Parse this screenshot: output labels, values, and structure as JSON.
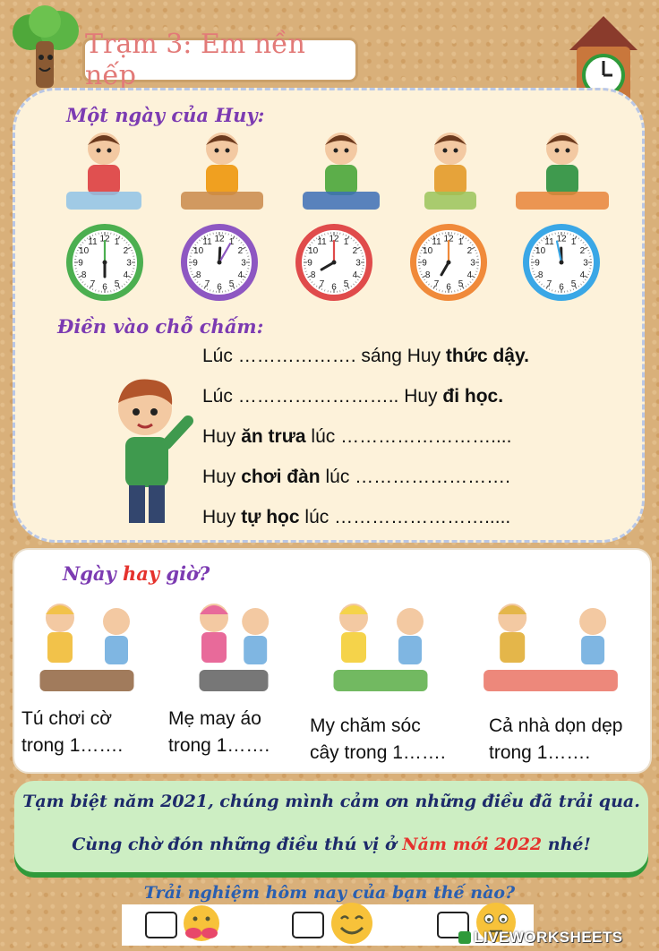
{
  "title": "Trạm 3: Em nền nếp",
  "schedule": {
    "heading": "Một ngày của Huy:",
    "activities": [
      {
        "name": "wake-up",
        "icon": "boy-waking-in-bed"
      },
      {
        "name": "play-guitar",
        "icon": "boy-playing-guitar"
      },
      {
        "name": "study",
        "icon": "boy-studying-at-desk"
      },
      {
        "name": "go-to-school",
        "icon": "boy-walking-to-school"
      },
      {
        "name": "lunch",
        "icon": "boy-eating-lunch"
      }
    ],
    "clocks": [
      {
        "color": "#4caf50",
        "hour": 6,
        "minute": 0
      },
      {
        "color": "#8e57c2",
        "hour": 12,
        "minute": 5
      },
      {
        "color": "#e04b4b",
        "hour": 8,
        "minute": 0
      },
      {
        "color": "#f08a3a",
        "hour": 7,
        "minute": 0
      },
      {
        "color": "#3aa7e6",
        "hour": 11,
        "minute": 58
      }
    ],
    "clock_numbers": [
      "12",
      "1",
      "2",
      "3",
      "4",
      "5",
      "6",
      "7",
      "8",
      "9",
      "10",
      "11"
    ]
  },
  "fill": {
    "heading": "Điền vào chỗ chấm:",
    "lines": [
      {
        "a": "Lúc ………………. sáng Huy ",
        "b": "thức dậy."
      },
      {
        "a": "Lúc …………………….. Huy ",
        "b": "đi học."
      },
      {
        "a": "Huy ",
        "b": "ăn trưa",
        "c": " lúc ……………………...."
      },
      {
        "a": "Huy ",
        "b": "chơi đàn",
        "c": " lúc ……………………."
      },
      {
        "a": "Huy ",
        "b": "tự học",
        "c": " lúc ……………………....."
      }
    ]
  },
  "day_or_hour": {
    "heading_a": "Ngày ",
    "heading_b": "hay",
    "heading_c": " giờ?",
    "items": [
      {
        "caption": "Tú chơi cờ\ntrong 1…….",
        "icon": "kids-playing-chess"
      },
      {
        "caption": "Mẹ may áo\ntrong 1…….",
        "icon": "mother-sewing"
      },
      {
        "caption": "My chăm sóc\ncây trong 1…….",
        "icon": "girl-watering-plants"
      },
      {
        "caption": "Cả nhà dọn dẹp\ntrong 1…….",
        "icon": "family-cleaning"
      }
    ]
  },
  "farewell": {
    "line1": "Tạm biệt năm 2021, chúng mình cảm ơn những điều đã trải qua.",
    "line2_a": "Cùng chờ đón những điều thú vị ở ",
    "line2_b": "Năm mới 2022",
    "line2_c": " nhé!"
  },
  "feedback": {
    "question": "Trải nghiệm hôm nay của bạn thế nào?",
    "options": [
      {
        "icon": "hugging-face-icon"
      },
      {
        "icon": "smiling-face-icon"
      },
      {
        "icon": "neutral-face-icon"
      }
    ]
  },
  "brand": "LIVEWORKSHEETS",
  "colors": {
    "purple": "#7c3bb2",
    "red": "#e5322d",
    "green": "#2f9a3a"
  }
}
